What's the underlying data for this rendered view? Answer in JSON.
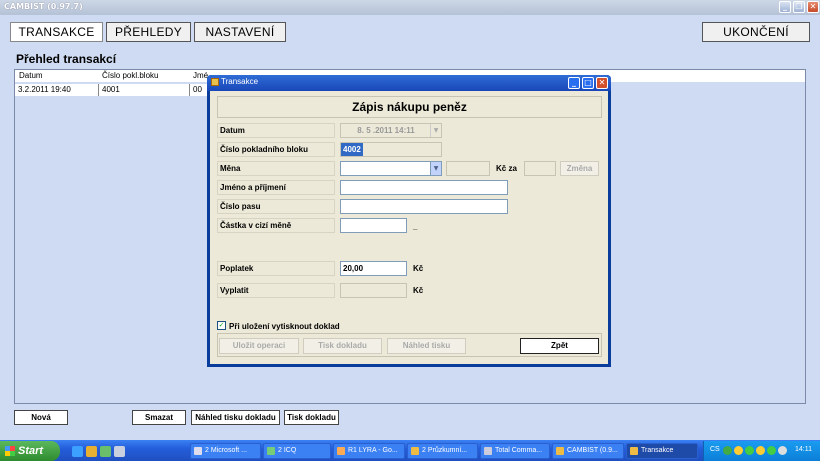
{
  "app": {
    "title": "CAMBIST (0.97.7)"
  },
  "tabs": [
    {
      "label": "TRANSAKCE",
      "active": true
    },
    {
      "label": "PŘEHLEDY",
      "active": false
    },
    {
      "label": "NASTAVENÍ",
      "active": false
    }
  ],
  "exit_label": "UKONČENÍ",
  "section_title": "Přehled transakcí",
  "grid": {
    "columns": [
      "Datum",
      "Číslo pokl.bloku",
      "Jmé",
      ""
    ],
    "rows": [
      [
        "3.2.2011 19:40",
        "4001",
        "00"
      ]
    ]
  },
  "bottom_buttons": {
    "new": "Nová",
    "delete": "Smazat",
    "print_preview": "Náhled tisku dokladu",
    "print": "Tisk dokladu"
  },
  "dialog": {
    "title": "Transakce",
    "heading": "Zápis nákupu peněz",
    "fields": {
      "date": {
        "label": "Datum",
        "value": "8. 5 .2011 14:11"
      },
      "receipt": {
        "label": "Číslo pokladního bloku",
        "value": "4002"
      },
      "currency": {
        "label": "Měna",
        "value": "",
        "rate_label": "Kč za",
        "change_label": "Změna"
      },
      "name": {
        "label": "Jméno a příjmení",
        "value": ""
      },
      "passport": {
        "label": "Číslo pasu",
        "value": ""
      },
      "amount": {
        "label": "Částka v cizí měně",
        "value": "",
        "suffix": "_"
      },
      "fee": {
        "label": "Poplatek",
        "value": "20,00",
        "unit": "Kč"
      },
      "payout": {
        "label": "Vyplatit",
        "value": "",
        "unit": "Kč"
      }
    },
    "print_on_save": {
      "label": "Při uložení vytisknout doklad",
      "checked": true
    },
    "buttons": {
      "save": "Uložit operaci",
      "print": "Tisk dokladu",
      "preview": "Náhled tisku",
      "back": "Zpět"
    }
  },
  "taskbar": {
    "start": "Start",
    "tasks": [
      "2 Microsoft ...",
      "2 ICQ",
      "R1 LYRA - Go...",
      "2 Průzkumní...",
      "Total Comma...",
      "CAMBIST (0.9...",
      "Transakce"
    ],
    "lang": "CS",
    "clock": "14:11"
  },
  "colors": {
    "client_bg": "#cfdbf2",
    "dialog_title": "#1947b8",
    "taskbar": "#245edb",
    "start": "#2d8a2d"
  }
}
